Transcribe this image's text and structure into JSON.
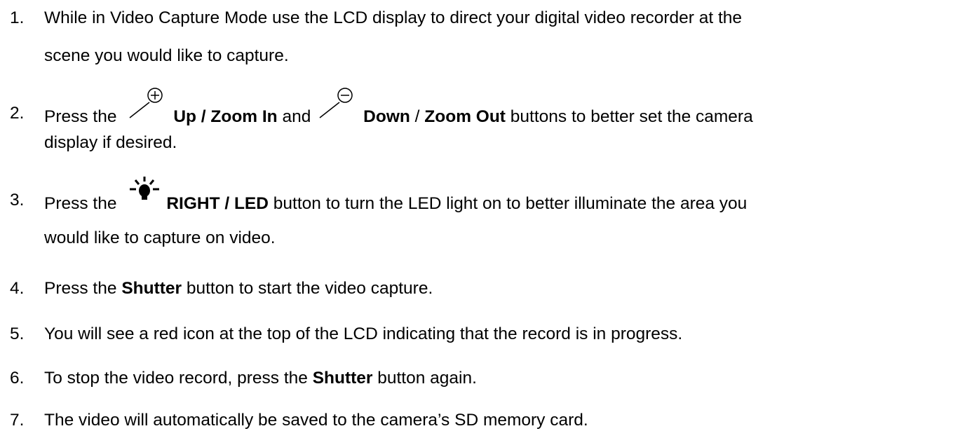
{
  "steps": [
    {
      "number": "1.",
      "line1": "While in Video Capture Mode use the LCD display to direct your digital video recorder at the",
      "line2": "scene you would like to capture."
    },
    {
      "number": "2.",
      "prefix": "Press the",
      "zoom_in_label": "Up / Zoom In",
      "and": "and",
      "down_label": "Down",
      "slash": "/",
      "zoom_out_label": "Zoom Out",
      "suffix": "buttons to better set the camera",
      "line2": "display if desired.",
      "icons": [
        "zoom-in-icon",
        "zoom-out-icon"
      ]
    },
    {
      "number": "3.",
      "prefix": "Press the",
      "led_label": "RIGHT / LED",
      "suffix": "button to turn the LED light on to better illuminate the area you",
      "line2": "would like to capture on video.",
      "icons": [
        "led-light-icon"
      ]
    },
    {
      "number": "4.",
      "prefix": "Press the",
      "bold": "Shutter",
      "suffix": "button to start the video capture."
    },
    {
      "number": "5.",
      "text": "You will see a red icon at the top of the LCD indicating that the record is in progress."
    },
    {
      "number": "6.",
      "prefix": "To stop the video record, press the",
      "bold": "Shutter",
      "suffix": "button again."
    },
    {
      "number": "7.",
      "text": "The video will automatically be saved to the camera’s SD memory card."
    }
  ]
}
